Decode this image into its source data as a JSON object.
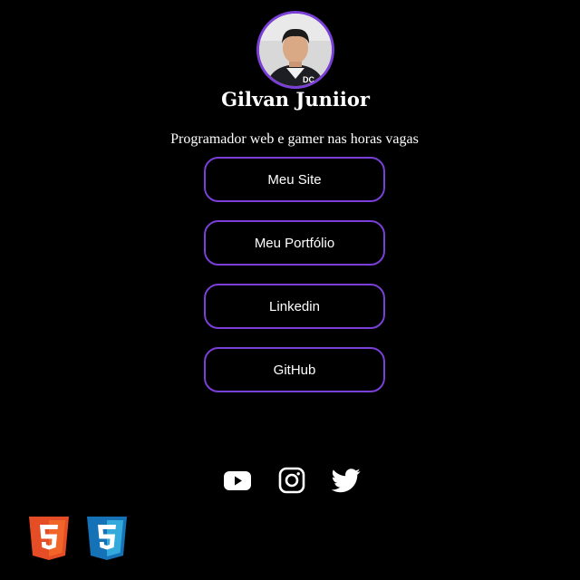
{
  "profile": {
    "name": "Gilvan Juniior",
    "bio": "Programador web e gamer nas horas vagas",
    "avatar_icon": "profile-photo",
    "accent_color": "#7a3fd6"
  },
  "links": [
    {
      "label": "Meu Site"
    },
    {
      "label": "Meu Portfólio"
    },
    {
      "label": "Linkedin"
    },
    {
      "label": "GitHub"
    }
  ],
  "social": [
    {
      "icon": "youtube-icon"
    },
    {
      "icon": "instagram-icon"
    },
    {
      "icon": "twitter-icon"
    }
  ],
  "tech_badges": [
    {
      "icon": "html5-icon",
      "color": "#e44d26"
    },
    {
      "icon": "css3-icon",
      "color": "#1572b6"
    }
  ]
}
